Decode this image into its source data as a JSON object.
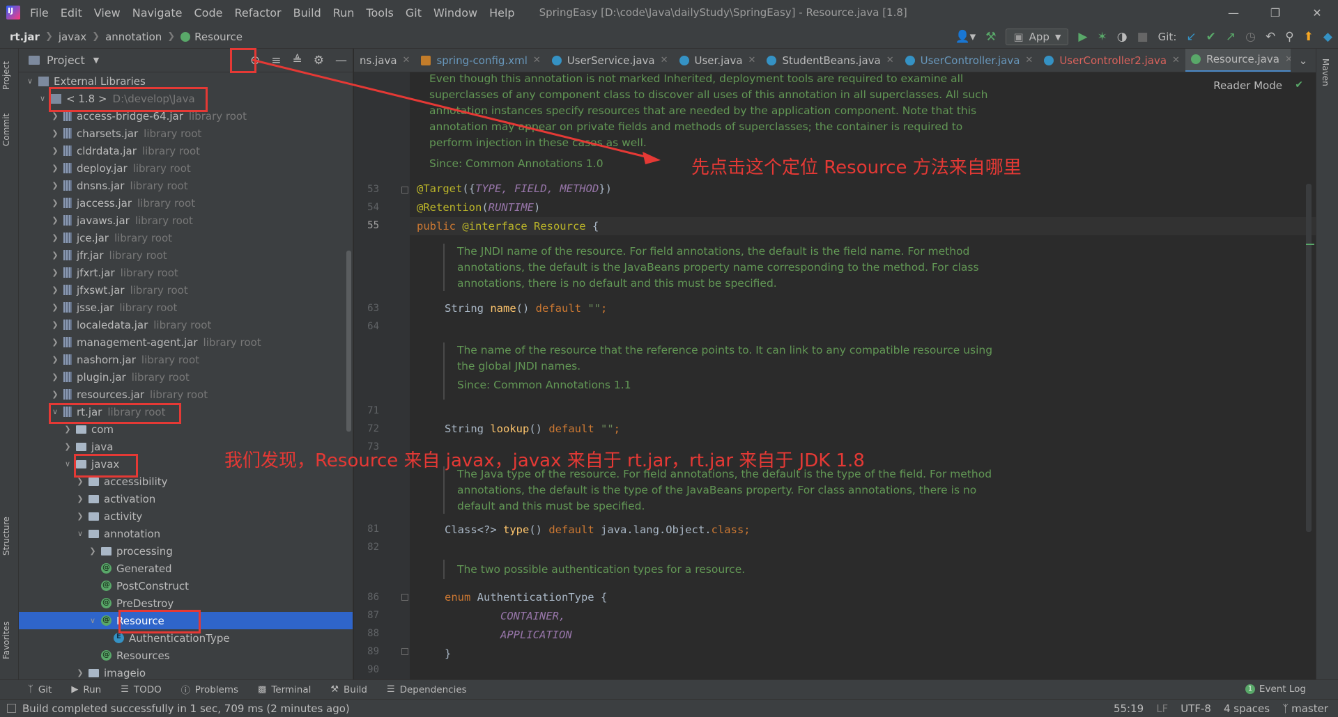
{
  "window": {
    "title": "SpringEasy [D:\\code\\Java\\dailyStudy\\SpringEasy] - Resource.java [1.8]",
    "menu": [
      "File",
      "Edit",
      "View",
      "Navigate",
      "Code",
      "Refactor",
      "Build",
      "Run",
      "Tools",
      "Git",
      "Window",
      "Help"
    ]
  },
  "breadcrumb": {
    "items": [
      "rt.jar",
      "javax",
      "annotation",
      "Resource"
    ]
  },
  "toolbar": {
    "run_config": "App",
    "git_label": "Git:"
  },
  "project_panel": {
    "title": "Project",
    "tree": [
      {
        "label": "External Libraries",
        "depth": 0,
        "state": "expanded",
        "icon": "library-icon",
        "hint": ""
      },
      {
        "label": "< 1.8 >",
        "depth": 1,
        "state": "expanded",
        "icon": "jdk-icon",
        "hint": "D:\\develop\\Java"
      },
      {
        "label": "access-bridge-64.jar",
        "depth": 2,
        "state": "collapsed",
        "icon": "jar-icon",
        "hint": "library root"
      },
      {
        "label": "charsets.jar",
        "depth": 2,
        "state": "collapsed",
        "icon": "jar-icon",
        "hint": "library root"
      },
      {
        "label": "cldrdata.jar",
        "depth": 2,
        "state": "collapsed",
        "icon": "jar-icon",
        "hint": "library root"
      },
      {
        "label": "deploy.jar",
        "depth": 2,
        "state": "collapsed",
        "icon": "jar-icon",
        "hint": "library root"
      },
      {
        "label": "dnsns.jar",
        "depth": 2,
        "state": "collapsed",
        "icon": "jar-icon",
        "hint": "library root"
      },
      {
        "label": "jaccess.jar",
        "depth": 2,
        "state": "collapsed",
        "icon": "jar-icon",
        "hint": "library root"
      },
      {
        "label": "javaws.jar",
        "depth": 2,
        "state": "collapsed",
        "icon": "jar-icon",
        "hint": "library root"
      },
      {
        "label": "jce.jar",
        "depth": 2,
        "state": "collapsed",
        "icon": "jar-icon",
        "hint": "library root"
      },
      {
        "label": "jfr.jar",
        "depth": 2,
        "state": "collapsed",
        "icon": "jar-icon",
        "hint": "library root"
      },
      {
        "label": "jfxrt.jar",
        "depth": 2,
        "state": "collapsed",
        "icon": "jar-icon",
        "hint": "library root"
      },
      {
        "label": "jfxswt.jar",
        "depth": 2,
        "state": "collapsed",
        "icon": "jar-icon",
        "hint": "library root"
      },
      {
        "label": "jsse.jar",
        "depth": 2,
        "state": "collapsed",
        "icon": "jar-icon",
        "hint": "library root"
      },
      {
        "label": "localedata.jar",
        "depth": 2,
        "state": "collapsed",
        "icon": "jar-icon",
        "hint": "library root"
      },
      {
        "label": "management-agent.jar",
        "depth": 2,
        "state": "collapsed",
        "icon": "jar-icon",
        "hint": "library root"
      },
      {
        "label": "nashorn.jar",
        "depth": 2,
        "state": "collapsed",
        "icon": "jar-icon",
        "hint": "library root"
      },
      {
        "label": "plugin.jar",
        "depth": 2,
        "state": "collapsed",
        "icon": "jar-icon",
        "hint": "library root"
      },
      {
        "label": "resources.jar",
        "depth": 2,
        "state": "collapsed",
        "icon": "jar-icon",
        "hint": "library root"
      },
      {
        "label": "rt.jar",
        "depth": 2,
        "state": "expanded",
        "icon": "jar-icon",
        "hint": "library root"
      },
      {
        "label": "com",
        "depth": 3,
        "state": "collapsed",
        "icon": "folder-icon",
        "hint": ""
      },
      {
        "label": "java",
        "depth": 3,
        "state": "collapsed",
        "icon": "folder-icon",
        "hint": ""
      },
      {
        "label": "javax",
        "depth": 3,
        "state": "expanded",
        "icon": "folder-icon",
        "hint": ""
      },
      {
        "label": "accessibility",
        "depth": 4,
        "state": "collapsed",
        "icon": "folder-icon",
        "hint": ""
      },
      {
        "label": "activation",
        "depth": 4,
        "state": "collapsed",
        "icon": "folder-icon",
        "hint": ""
      },
      {
        "label": "activity",
        "depth": 4,
        "state": "collapsed",
        "icon": "folder-icon",
        "hint": ""
      },
      {
        "label": "annotation",
        "depth": 4,
        "state": "expanded",
        "icon": "folder-icon",
        "hint": ""
      },
      {
        "label": "processing",
        "depth": 5,
        "state": "collapsed",
        "icon": "folder-icon",
        "hint": ""
      },
      {
        "label": "Generated",
        "depth": 5,
        "state": "leaf",
        "icon": "annotation-icon",
        "hint": ""
      },
      {
        "label": "PostConstruct",
        "depth": 5,
        "state": "leaf",
        "icon": "annotation-icon",
        "hint": ""
      },
      {
        "label": "PreDestroy",
        "depth": 5,
        "state": "leaf",
        "icon": "annotation-icon",
        "hint": ""
      },
      {
        "label": "Resource",
        "depth": 5,
        "state": "expanded",
        "icon": "annotation-icon",
        "hint": "",
        "selected": true
      },
      {
        "label": "AuthenticationType",
        "depth": 6,
        "state": "leaf",
        "icon": "enum-icon",
        "hint": ""
      },
      {
        "label": "Resources",
        "depth": 5,
        "state": "leaf",
        "icon": "annotation-icon",
        "hint": ""
      },
      {
        "label": "imageio",
        "depth": 4,
        "state": "collapsed",
        "icon": "folder-icon",
        "hint": ""
      }
    ]
  },
  "editor_tabs": [
    {
      "label": "ns.java",
      "icon": "none",
      "color": "normal"
    },
    {
      "label": "spring-config.xml",
      "icon": "xml",
      "color": "blue"
    },
    {
      "label": "UserService.java",
      "icon": "class",
      "color": "normal"
    },
    {
      "label": "User.java",
      "icon": "class",
      "color": "normal"
    },
    {
      "label": "StudentBeans.java",
      "icon": "class",
      "color": "normal"
    },
    {
      "label": "UserController.java",
      "icon": "class",
      "color": "blue"
    },
    {
      "label": "UserController2.java",
      "icon": "class",
      "color": "red"
    },
    {
      "label": "Resource.java",
      "icon": "annotation",
      "color": "normal",
      "active": true
    }
  ],
  "editor": {
    "reader_mode": "Reader Mode",
    "doc_top": [
      "Even though this annotation is not marked Inherited, deployment tools are required to examine all",
      "superclasses of any component class to discover all uses of this annotation in all superclasses. All such",
      "annotation instances specify resources that are needed by the application component. Note that this",
      "annotation may appear on private fields and methods of superclasses; the container is required to",
      "perform injection in these cases as well."
    ],
    "doc_top_since": "Since: Common Annotations 1.0",
    "doc_name": [
      "The JNDI name of the resource. For field annotations, the default is the field name. For method",
      "annotations, the default is the JavaBeans property name corresponding to the method. For class",
      "annotations, there is no default and this must be specified."
    ],
    "doc_lookup": [
      "The name of the resource that the reference points to. It can link to any compatible resource using",
      "the global JNDI names."
    ],
    "doc_lookup_since": "Since: Common Annotations 1.1",
    "doc_type": [
      "The Java type of the resource. For field annotations, the default is the type of the field. For method",
      "annotations, the default is the type of the JavaBeans property. For class annotations, there is no",
      "default and this must be specified."
    ],
    "doc_auth": "The two possible authentication types for a resource.",
    "line_numbers": {
      "l53": "53",
      "l54": "54",
      "l55": "55",
      "l63": "63",
      "l64": "64",
      "l71": "71",
      "l72": "72",
      "l73": "73",
      "l81": "81",
      "l82": "82",
      "l86": "86",
      "l87": "87",
      "l88": "88",
      "l89": "89",
      "l90": "90"
    },
    "code": {
      "target_kw": "@Target",
      "target_open": "({",
      "target_args": "TYPE, FIELD, METHOD",
      "target_close": "})",
      "retention_kw": "@Retention",
      "retention_open": "(",
      "retention_arg": "RUNTIME",
      "retention_close": ")",
      "decl_public": "public ",
      "decl_at": "@interface ",
      "decl_name": "Resource",
      "decl_brace": " {",
      "name_type": "String ",
      "name_fn": "name",
      "name_paren": "() ",
      "name_default": "default ",
      "name_val": "\"\"",
      "name_semi": ";",
      "lookup_type": "String ",
      "lookup_fn": "lookup",
      "lookup_paren": "() ",
      "lookup_default": "default ",
      "lookup_val": "\"\"",
      "lookup_semi": ";",
      "type_type": "Class<?> ",
      "type_fn": "type",
      "type_paren": "() ",
      "type_default": "default ",
      "type_val": "java.lang.Object.",
      "type_class": "class",
      "type_semi": ";",
      "enum_kw": "enum ",
      "enum_name": "AuthenticationType {",
      "enum_c1": "CONTAINER,",
      "enum_c2": "APPLICATION",
      "enum_close": "}"
    }
  },
  "annotations": {
    "note1": "先点击这个定位 Resource 方法来自哪里",
    "note2": "我们发现，Resource 来自 javax，javax 来自于 rt.jar，rt.jar 来自于 JDK 1.8"
  },
  "bottom_tools": [
    "Git",
    "Run",
    "TODO",
    "Problems",
    "Terminal",
    "Build",
    "Dependencies"
  ],
  "event_log": {
    "count": "1",
    "label": "Event Log"
  },
  "status": {
    "message": "Build completed successfully in 1 sec, 709 ms (2 minutes ago)",
    "position": "55:19",
    "line_sep": "LF",
    "encoding": "UTF-8",
    "indent": "4 spaces",
    "branch": "master"
  },
  "side_tabs": {
    "project": "Project",
    "commit": "Commit",
    "structure": "Structure",
    "favorites": "Favorites",
    "maven": "Maven"
  }
}
